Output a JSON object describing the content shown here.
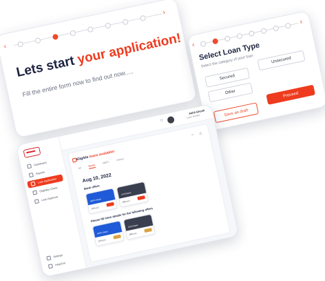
{
  "colors": {
    "accent": "#ee3b1f",
    "navy": "#1c2240",
    "blue_card": "#1f5bd8",
    "dark_card": "#3a3f4f",
    "amber": "#d9a441"
  },
  "card_a": {
    "title_plain": "Lets start ",
    "title_accent": "your application!",
    "subtitle": "Fill the entire form now to find out now.....",
    "nav_prev_icon": "chevron-left-icon",
    "nav_next_icon": "chevron-right-icon"
  },
  "card_b": {
    "title": "Select Loan Type",
    "subtitle": "Select the category of your loan",
    "options": [
      "Secured",
      "Unsecured",
      "Other"
    ],
    "save_label": "Save as draft",
    "proceed_label": "Proceed"
  },
  "card_c": {
    "user_name": "Akhil Ghosh",
    "user_role": "Loan Seeker",
    "nav_items": [
      "Dashboard",
      "Reports",
      "Loan Application",
      "Eligibility Check",
      "Loan Approval"
    ],
    "nav_bottom": [
      "Settings",
      "Help/Out"
    ],
    "eligible_plain": "Eligible ",
    "eligible_accent": "loans available!",
    "tabs": [
      "All",
      "Banks",
      "NBFC",
      "Others"
    ],
    "date": "Aug 10, 2022",
    "section1": "Bank offers",
    "section2": "Please fill more details for the following offers",
    "offers1": [
      {
        "bank": "HDFC Bank",
        "rate": "12% p.a."
      },
      {
        "bank": "AXIS Bank",
        "rate": "10% p.a."
      }
    ],
    "offers2": [
      {
        "bank": "HDFC Bank",
        "rate": "12% p.a."
      },
      {
        "bank": "ICICI Bank",
        "rate": "10% p.a."
      }
    ]
  }
}
